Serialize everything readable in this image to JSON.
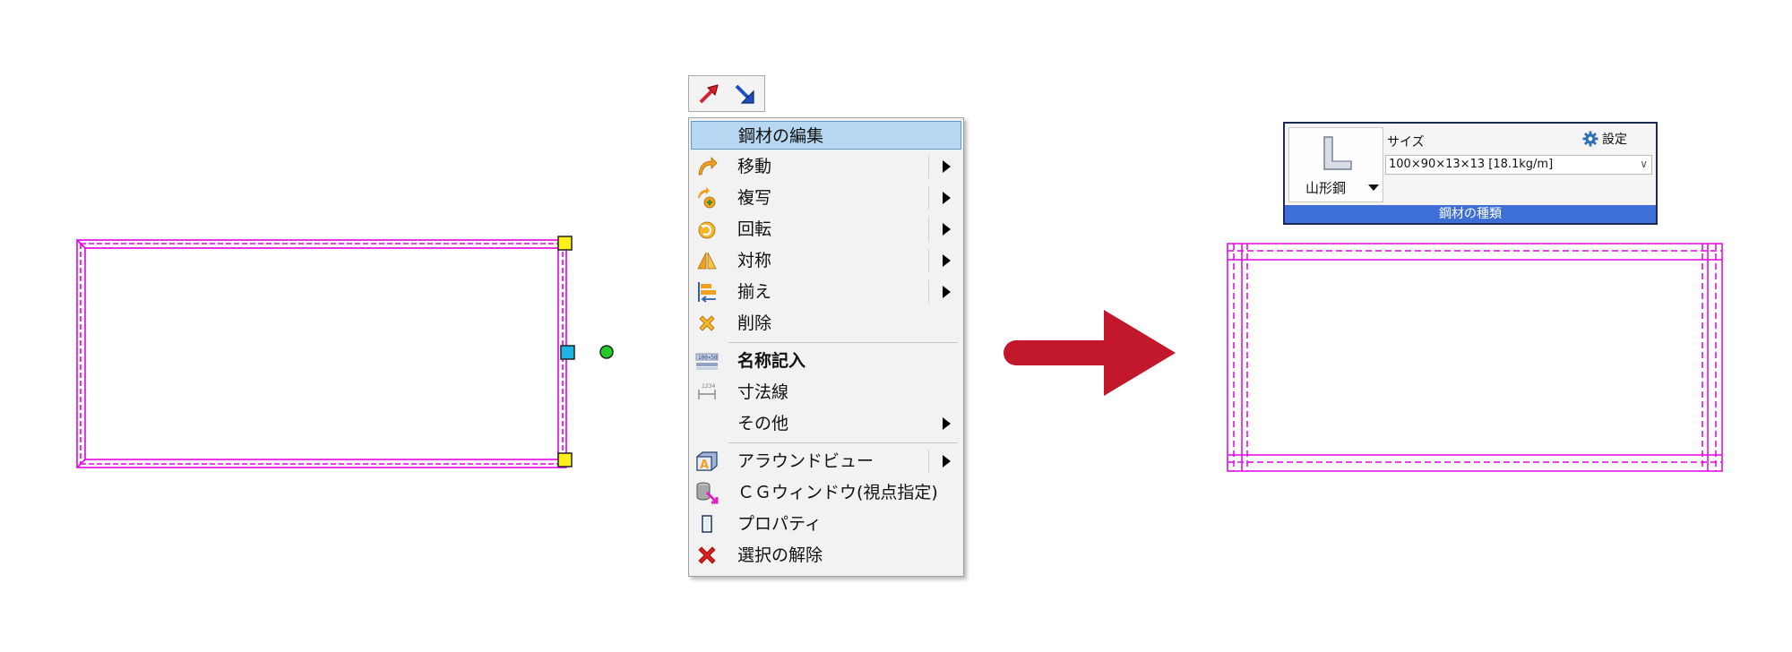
{
  "colors": {
    "member_line": "#e600e6",
    "handle_corner": "#ffef1a",
    "handle_mid": "#1fb4e8",
    "handle_rotate": "#22cc22",
    "menu_highlight": "#b7d6f1",
    "big_arrow": "#c3172b",
    "panel_caption_bg": "#3d6fd6"
  },
  "mini_toolbar": {
    "buttons": [
      {
        "icon": "red-arrow-up-icon"
      },
      {
        "icon": "blue-arrow-down-icon"
      }
    ]
  },
  "context_menu": {
    "items": [
      {
        "label": "鋼材の編集",
        "icon": "none",
        "submenu": false,
        "highlighted": true
      },
      {
        "label": "移動",
        "icon": "move-icon",
        "submenu": true
      },
      {
        "label": "複写",
        "icon": "copy-icon",
        "submenu": true
      },
      {
        "label": "回転",
        "icon": "rotate-icon",
        "submenu": true
      },
      {
        "label": "対称",
        "icon": "mirror-icon",
        "submenu": true
      },
      {
        "label": "揃え",
        "icon": "align-icon",
        "submenu": true
      },
      {
        "label": "削除",
        "icon": "delete-icon",
        "submenu": false
      },
      {
        "label": "名称記入",
        "icon": "name-label-icon",
        "submenu": false,
        "bold": true
      },
      {
        "label": "寸法線",
        "icon": "dimension-line-icon",
        "submenu": false
      },
      {
        "label": "その他",
        "icon": "none",
        "submenu": true
      },
      {
        "label": "アラウンドビュー",
        "icon": "around-view-icon",
        "submenu": true
      },
      {
        "label": "ＣＧウィンドウ(視点指定)",
        "icon": "cg-window-icon",
        "submenu": false
      },
      {
        "label": "プロパティ",
        "icon": "property-icon",
        "submenu": false
      },
      {
        "label": "選択の解除",
        "icon": "deselect-icon",
        "submenu": false
      }
    ]
  },
  "steel_panel": {
    "shape_label": "山形鋼",
    "size_caption": "サイズ",
    "settings_label": "設定",
    "size_value": "100×90×13×13 [18.1kg/m]",
    "caption": "鋼材の種類"
  }
}
